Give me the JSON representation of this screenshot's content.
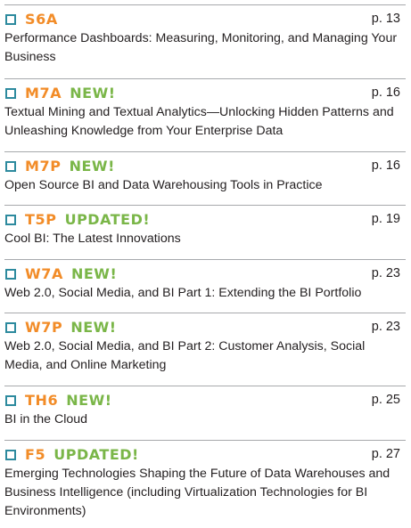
{
  "entries": [
    {
      "code": "S6A",
      "tag": "",
      "page": "p. 13",
      "title": "Performance Dashboards: Measuring, Monitoring, and Managing Your Business"
    },
    {
      "code": "M7A",
      "tag": "NEW!",
      "page": "p. 16",
      "title": "Textual Mining and Textual Analytics—Unlocking Hidden Patterns and Unleashing Knowledge from Your Enterprise Data"
    },
    {
      "code": "M7P",
      "tag": "NEW!",
      "page": "p. 16",
      "title": "Open Source BI and Data Warehousing Tools in Practice"
    },
    {
      "code": "T5P",
      "tag": "UPDATED!",
      "page": "p. 19",
      "title": "Cool BI: The Latest Innovations"
    },
    {
      "code": "W7A",
      "tag": "NEW!",
      "page": "p. 23",
      "title": "Web 2.0, Social Media, and BI Part 1: Extending the BI Portfolio"
    },
    {
      "code": "W7P",
      "tag": "NEW!",
      "page": "p. 23",
      "title": "Web 2.0, Social Media, and BI Part 2: Customer Analysis, Social Media, and Online Marketing"
    },
    {
      "code": "TH6",
      "tag": "NEW!",
      "page": "p. 25",
      "title": "BI in the Cloud"
    },
    {
      "code": "F5",
      "tag": "UPDATED!",
      "page": "p. 27",
      "title": "Emerging Technologies Shaping the Future of Data Warehouses and Business Intelligence (including Virtualization Technologies for BI Environments)"
    }
  ],
  "colors": {
    "code": "#f28c28",
    "tag": "#7ab648",
    "checkbox_border": "#2d8a9e",
    "divider": "#a7a9ac",
    "text": "#231f20"
  },
  "icons": {
    "checkbox": "checkbox-icon"
  }
}
